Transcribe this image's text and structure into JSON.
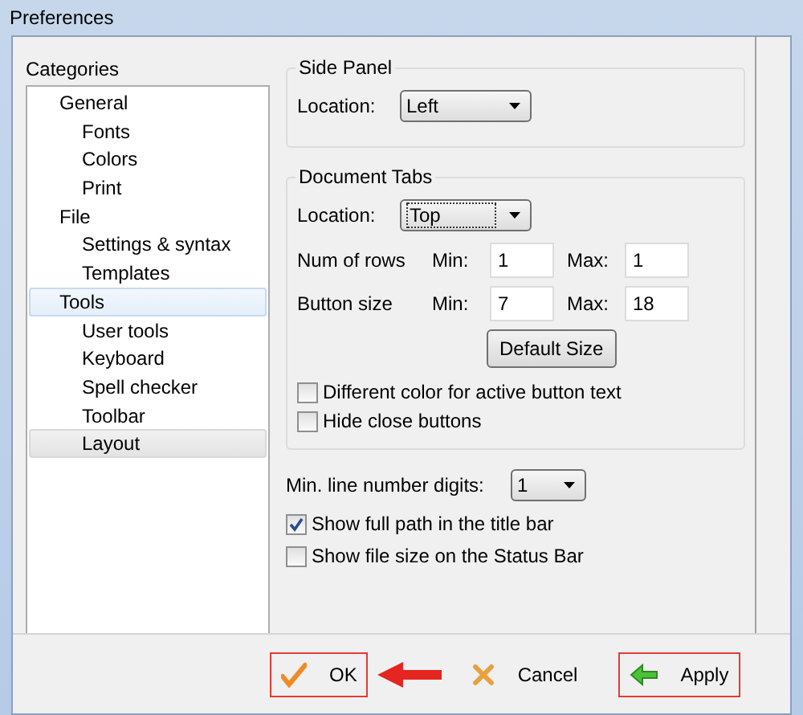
{
  "window": {
    "title": "Preferences"
  },
  "categories": {
    "label": "Categories",
    "items": [
      {
        "label": "General",
        "selected": false,
        "hovered": false,
        "children": [
          {
            "label": "Fonts",
            "selected": false,
            "hovered": false
          },
          {
            "label": "Colors",
            "selected": false,
            "hovered": false
          },
          {
            "label": "Print",
            "selected": false,
            "hovered": false
          }
        ]
      },
      {
        "label": "File",
        "selected": false,
        "hovered": false,
        "children": [
          {
            "label": "Settings & syntax",
            "selected": false,
            "hovered": false
          },
          {
            "label": "Templates",
            "selected": false,
            "hovered": false
          }
        ]
      },
      {
        "label": "Tools",
        "selected": false,
        "hovered": true,
        "children": [
          {
            "label": "User tools",
            "selected": false,
            "hovered": false
          },
          {
            "label": "Keyboard",
            "selected": false,
            "hovered": false
          },
          {
            "label": "Spell checker",
            "selected": false,
            "hovered": false
          },
          {
            "label": "Toolbar",
            "selected": false,
            "hovered": false
          },
          {
            "label": "Layout",
            "selected": true,
            "hovered": false
          }
        ]
      }
    ]
  },
  "side_panel": {
    "title": "Side Panel",
    "location_label": "Location:",
    "location": "Left"
  },
  "document_tabs": {
    "title": "Document Tabs",
    "location_label": "Location:",
    "location": "Top",
    "rows": [
      {
        "label": "Num of rows",
        "min_label": "Min:",
        "min": "1",
        "max_label": "Max:",
        "max": "1"
      },
      {
        "label": "Button size",
        "min_label": "Min:",
        "min": "7",
        "max_label": "Max:",
        "max": "18"
      }
    ],
    "default_button": "Default Size",
    "options": [
      {
        "label": "Different color for active button text",
        "checked": false
      },
      {
        "label": "Hide close buttons",
        "checked": false
      }
    ]
  },
  "line_digits": {
    "label": "Min. line number digits:",
    "value": "1"
  },
  "options": [
    {
      "label": "Show full path in the title bar",
      "checked": true
    },
    {
      "label": "Show file size on the Status Bar",
      "checked": false
    }
  ],
  "buttons": [
    {
      "label": "OK",
      "kind": "ok",
      "highlighted": true
    },
    {
      "label": "Cancel",
      "kind": "cancel",
      "highlighted": false
    },
    {
      "label": "Apply",
      "kind": "apply",
      "highlighted": true
    }
  ]
}
